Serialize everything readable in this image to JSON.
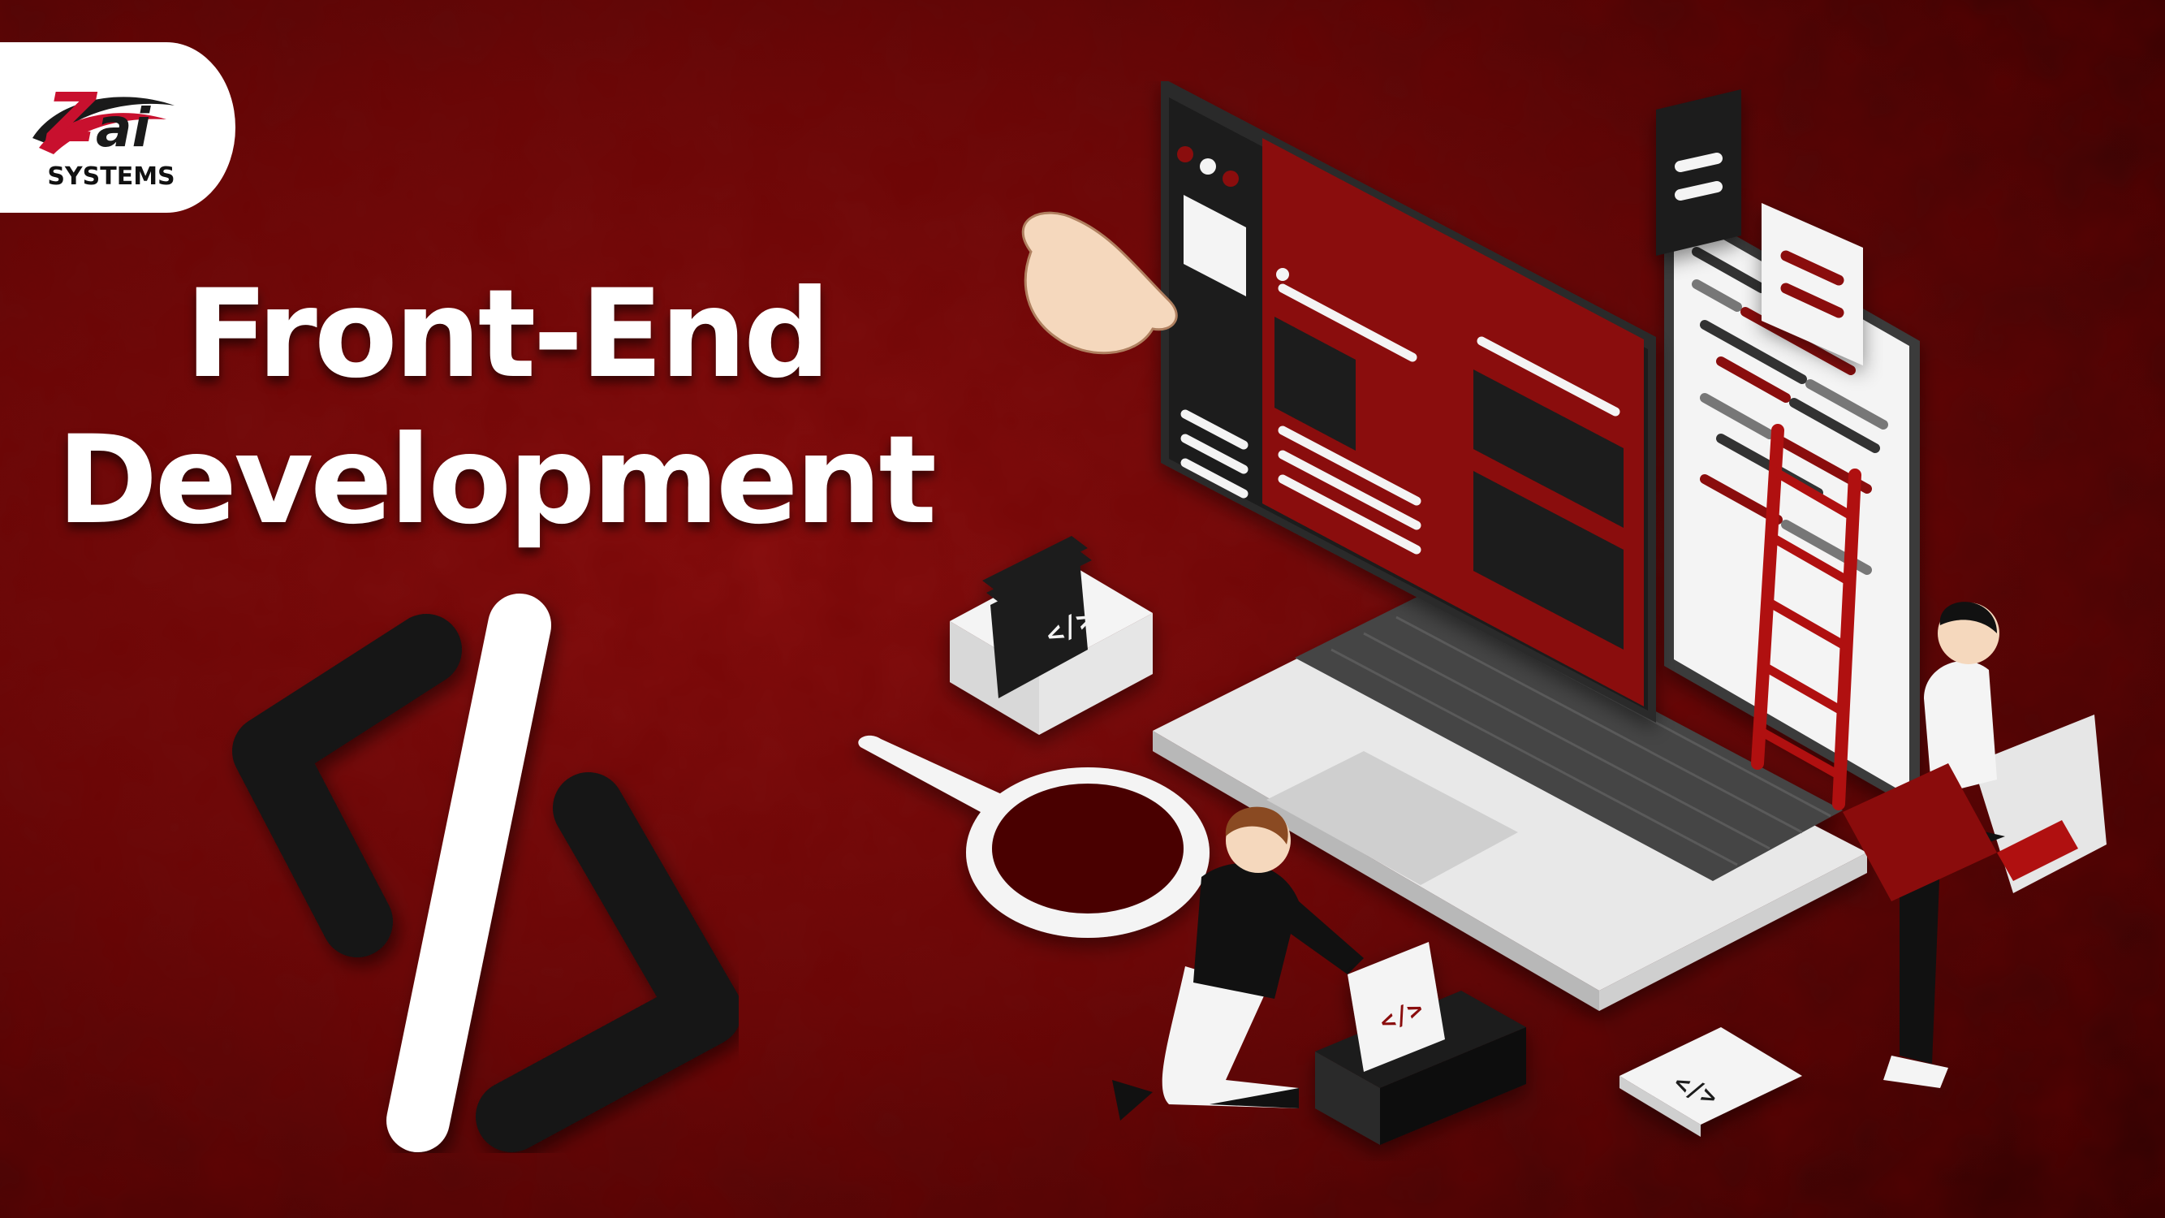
{
  "brand": {
    "logo_mark": "Zai",
    "logo_subtitle": "SYSTEMS",
    "accent_color": "#8b1a1a",
    "logo_red": "#c8102e"
  },
  "headline": {
    "line1": "Front-End",
    "line2": "Development"
  },
  "icon_glyphs": {
    "code_tag": "</>"
  },
  "colors": {
    "background_dark": "#3a0404",
    "background_mid": "#7a0e0e",
    "screen_red": "#8a0c0c",
    "panel_black": "#1c1c1c",
    "panel_white": "#f4f4f4"
  }
}
